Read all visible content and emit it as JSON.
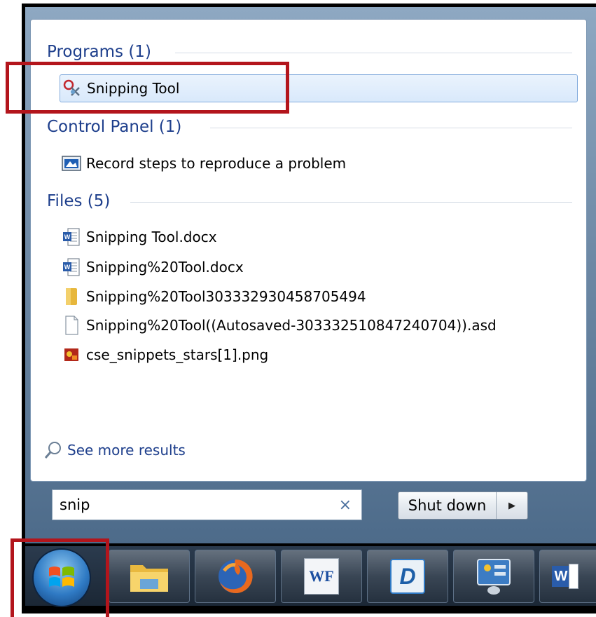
{
  "sections": {
    "programs": {
      "title": "Programs (1)"
    },
    "control_panel": {
      "title": "Control Panel (1)"
    },
    "files": {
      "title": "Files (5)"
    }
  },
  "programs_items": [
    {
      "label": "Snipping Tool",
      "icon": "scissors-icon"
    }
  ],
  "control_panel_items": [
    {
      "label": "Record steps to reproduce a problem",
      "icon": "steps-recorder-icon"
    }
  ],
  "files_items": [
    {
      "label": "Snipping Tool.docx",
      "icon": "word-doc-icon"
    },
    {
      "label": "Snipping%20Tool.docx",
      "icon": "word-doc-icon"
    },
    {
      "label": "Snipping%20Tool303332930458705494",
      "icon": "folder-icon"
    },
    {
      "label": "Snipping%20Tool((Autosaved-303332510847240704)).asd",
      "icon": "blank-file-icon"
    },
    {
      "label": "cse_snippets_stars[1].png",
      "icon": "image-file-icon"
    }
  ],
  "see_more": {
    "label": "See more results",
    "icon": "magnifier-icon"
  },
  "search": {
    "value": "snip",
    "clear_glyph": "×"
  },
  "shutdown": {
    "label": "Shut down",
    "arrow": "▶"
  },
  "taskbar": {
    "items": [
      {
        "name": "start-orb",
        "icon": "windows-logo-icon"
      },
      {
        "name": "explorer",
        "icon": "folder-icon"
      },
      {
        "name": "firefox",
        "icon": "firefox-icon"
      },
      {
        "name": "wf-app",
        "icon": "wf-icon",
        "text": "WF"
      },
      {
        "name": "d-app",
        "icon": "d-app-icon",
        "text": "D"
      },
      {
        "name": "control-panel",
        "icon": "control-panel-icon"
      },
      {
        "name": "word",
        "icon": "word-icon",
        "text": "W"
      }
    ]
  },
  "colors": {
    "heading": "#1e3f8c",
    "highlight_border": "#84acdd",
    "highlight_fill": "#dbe9fb",
    "annotation_red": "#b3151c",
    "taskbar": "#1b2735"
  }
}
